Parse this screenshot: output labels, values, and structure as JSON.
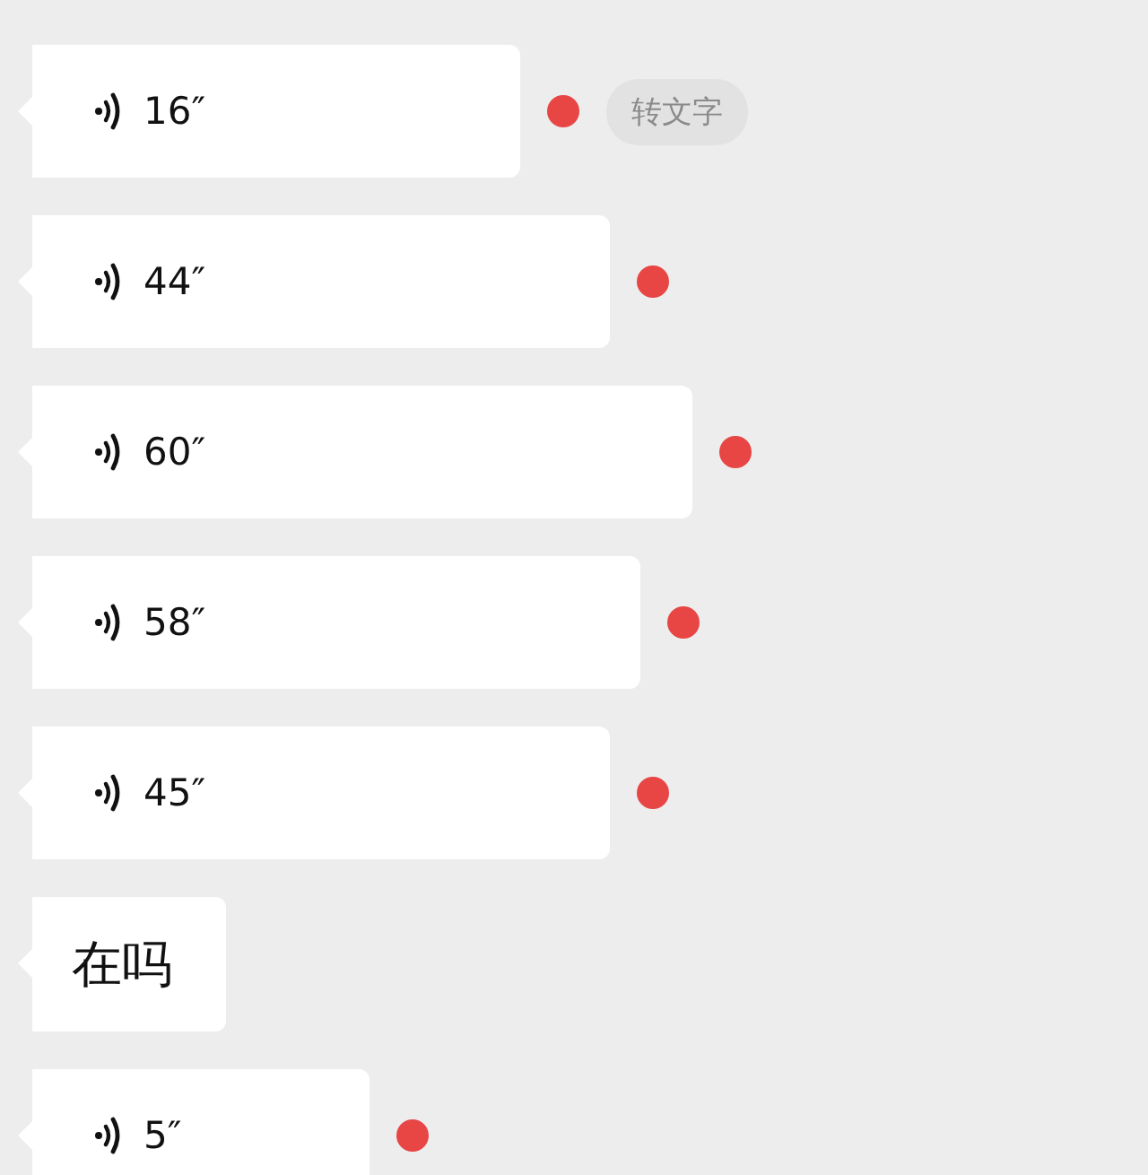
{
  "messages": [
    {
      "kind": "voice",
      "duration": "16″",
      "unread": true,
      "transcribe_button": "转文字"
    },
    {
      "kind": "voice",
      "duration": "44″",
      "unread": true
    },
    {
      "kind": "voice",
      "duration": "60″",
      "unread": true
    },
    {
      "kind": "voice",
      "duration": "58″",
      "unread": true
    },
    {
      "kind": "voice",
      "duration": "45″",
      "unread": true
    },
    {
      "kind": "text",
      "text": "在吗"
    },
    {
      "kind": "voice",
      "duration": "5″",
      "unread": true
    }
  ]
}
